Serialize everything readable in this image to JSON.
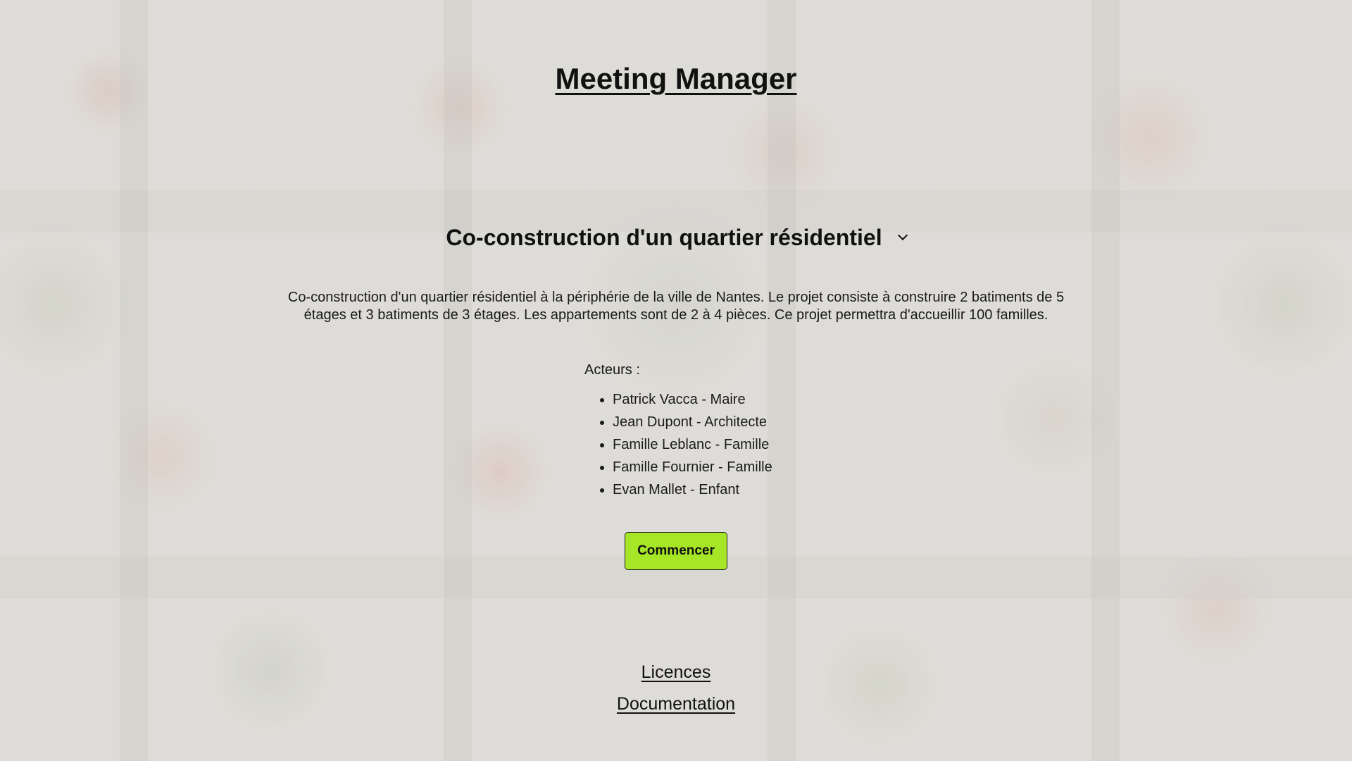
{
  "app": {
    "title": "Meeting Manager"
  },
  "project": {
    "selected_title": "Co-construction d'un quartier résidentiel",
    "dropdown_icon": "chevron-down-icon",
    "description": "Co-construction d'un quartier résidentiel à la périphérie de la ville de Nantes. Le projet consiste à construire 2 batiments de 5 étages et 3 batiments de 3 étages. Les appartements sont de 2 à 4 pièces. Ce projet permettra d'accueillir 100 familles."
  },
  "actors": {
    "label": "Acteurs :",
    "items": [
      "Patrick Vacca - Maire",
      "Jean Dupont - Architecte",
      "Famille Leblanc - Famille",
      "Famille Fournier - Famille",
      "Evan Mallet - Enfant"
    ]
  },
  "actions": {
    "start_label": "Commencer",
    "start_color": "#a6e626"
  },
  "footer": {
    "licences_label": "Licences",
    "documentation_label": "Documentation"
  }
}
